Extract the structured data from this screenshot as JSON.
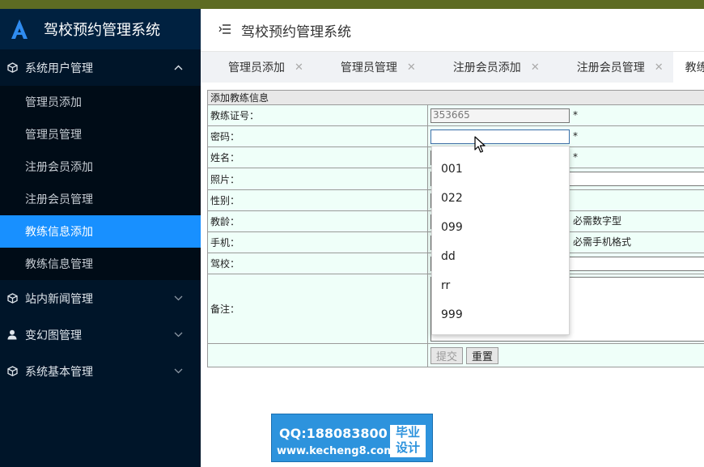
{
  "app": {
    "title": "驾校预约管理系统"
  },
  "sidebar": {
    "groups": [
      {
        "label": "系统用户管理",
        "icon": "cube-icon",
        "expanded": true
      },
      {
        "label": "站内新闻管理",
        "icon": "cube-icon",
        "expanded": false
      },
      {
        "label": "变幻图管理",
        "icon": "user-icon",
        "expanded": false
      },
      {
        "label": "系统基本管理",
        "icon": "cube-icon",
        "expanded": false
      }
    ],
    "items": [
      {
        "label": "管理员添加"
      },
      {
        "label": "管理员管理"
      },
      {
        "label": "注册会员添加"
      },
      {
        "label": "注册会员管理"
      },
      {
        "label": "教练信息添加",
        "active": true
      },
      {
        "label": "教练信息管理"
      }
    ]
  },
  "header": {
    "title": "驾校预约管理系统"
  },
  "tabs": [
    {
      "label": "管理员添加"
    },
    {
      "label": "管理员管理"
    },
    {
      "label": "注册会员添加"
    },
    {
      "label": "注册会员管理"
    },
    {
      "label": "教练信息",
      "active": true
    }
  ],
  "form": {
    "heading": "添加教练信息",
    "fields": {
      "coach_id": {
        "label": "教练证号：",
        "value": "353665",
        "required": "*"
      },
      "password": {
        "label": "密码：",
        "value": "",
        "required": "*"
      },
      "name": {
        "label": "姓名：",
        "required": "*"
      },
      "photo": {
        "label": "照片："
      },
      "gender": {
        "label": "性别："
      },
      "years": {
        "label": "教龄：",
        "hint": "必需数字型"
      },
      "phone": {
        "label": "手机：",
        "hint": "必需手机格式"
      },
      "school": {
        "label": "驾校："
      },
      "remark": {
        "label": "备注："
      }
    },
    "submit_label": "提交",
    "reset_label": "重置"
  },
  "autocomplete": {
    "options": [
      "001",
      "022",
      "099",
      "dd",
      "rr",
      "999"
    ]
  },
  "watermark": {
    "qq": "QQ:188083800",
    "url": "www.kecheng8.com",
    "badge_line1": "毕业",
    "badge_line2": "设计"
  },
  "colors": {
    "sidebar_bg": "#001529",
    "active_item": "#1890ff",
    "form_bg": "#effff9",
    "watermark_bg": "#2d93dd"
  }
}
